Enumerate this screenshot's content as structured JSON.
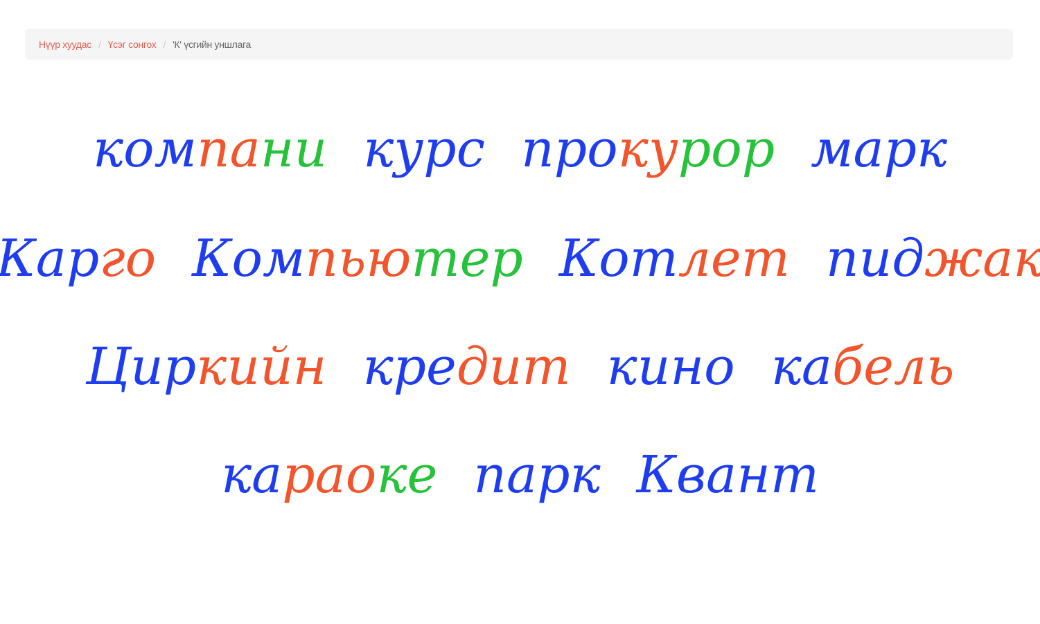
{
  "breadcrumb": {
    "home": "Нүүр хуудас",
    "catalog": "Үсэг сонгох",
    "current": "'К' үсгийн уншлага"
  },
  "colors": {
    "primary": "#1f3df0",
    "secondary": "#f2552c",
    "tertiary": "#25c23a",
    "link": "#e0604f"
  },
  "lines": [
    [
      [
        {
          "t": "ком",
          "c": "blue"
        },
        {
          "t": "па",
          "c": "orange"
        },
        {
          "t": "ни",
          "c": "green"
        }
      ],
      [
        {
          "t": "курс",
          "c": "blue"
        }
      ],
      [
        {
          "t": "про",
          "c": "blue"
        },
        {
          "t": "ку",
          "c": "orange"
        },
        {
          "t": "рор",
          "c": "green"
        }
      ],
      [
        {
          "t": "марк",
          "c": "blue"
        }
      ]
    ],
    [
      [
        {
          "t": "Кар",
          "c": "blue"
        },
        {
          "t": "го",
          "c": "orange"
        }
      ],
      [
        {
          "t": "Ком",
          "c": "blue"
        },
        {
          "t": "пью",
          "c": "orange"
        },
        {
          "t": "тер",
          "c": "green"
        }
      ],
      [
        {
          "t": "Кот",
          "c": "blue"
        },
        {
          "t": "лет",
          "c": "orange"
        }
      ],
      [
        {
          "t": "пид",
          "c": "blue"
        },
        {
          "t": "жак",
          "c": "orange"
        }
      ]
    ],
    [
      [
        {
          "t": "Цир",
          "c": "blue"
        },
        {
          "t": "кийн",
          "c": "orange"
        }
      ],
      [
        {
          "t": "кре",
          "c": "blue"
        },
        {
          "t": "дит",
          "c": "orange"
        }
      ],
      [
        {
          "t": "кино",
          "c": "blue"
        }
      ],
      [
        {
          "t": "ка",
          "c": "blue"
        },
        {
          "t": "бель",
          "c": "orange"
        }
      ]
    ],
    [
      [
        {
          "t": "ка",
          "c": "blue"
        },
        {
          "t": "рао",
          "c": "orange"
        },
        {
          "t": "ке",
          "c": "green"
        }
      ],
      [
        {
          "t": "парк",
          "c": "blue"
        }
      ],
      [
        {
          "t": "Квант",
          "c": "blue"
        }
      ]
    ]
  ]
}
